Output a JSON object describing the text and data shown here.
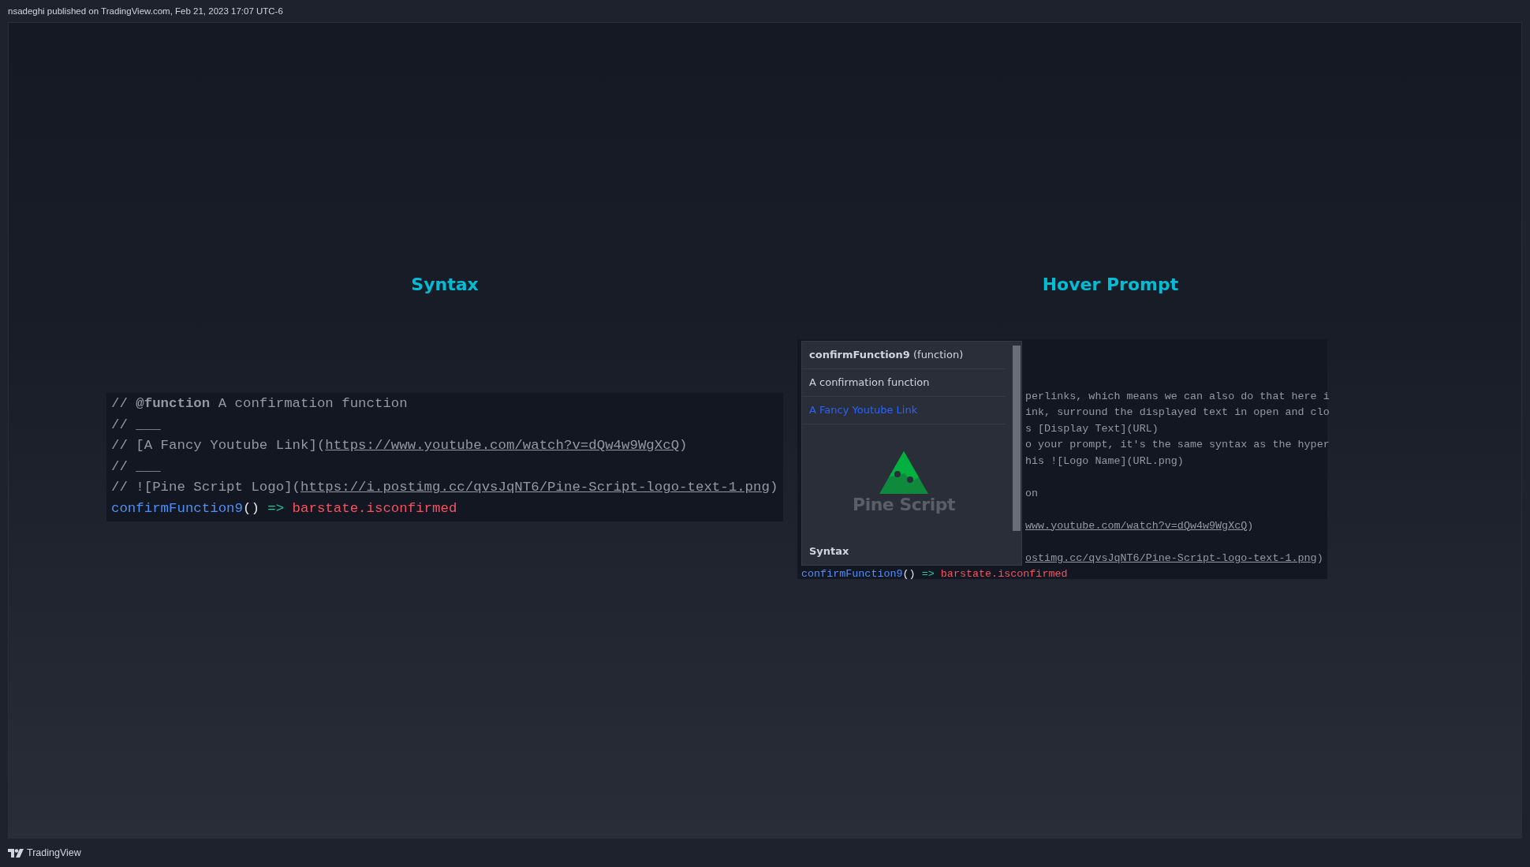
{
  "header": {
    "byline": "nsadeghi published on TradingView.com, Feb 21, 2023 17:07 UTC-6"
  },
  "syntax_panel": {
    "title": "Syntax",
    "lines": [
      {
        "segments": [
          {
            "text": "// ",
            "kind": "comment"
          },
          {
            "text": "@function",
            "kind": "tag"
          },
          {
            "text": " A confirmation function",
            "kind": "comment"
          }
        ]
      },
      {
        "segments": [
          {
            "text": "// ___",
            "kind": "comment"
          }
        ]
      },
      {
        "segments": [
          {
            "text": "// [A Fancy Youtube Link](",
            "kind": "comment"
          },
          {
            "text": "https://www.youtube.com/watch?v=dQw4w9WgXcQ",
            "kind": "link"
          },
          {
            "text": ")",
            "kind": "comment"
          }
        ]
      },
      {
        "segments": [
          {
            "text": "// ___",
            "kind": "comment"
          }
        ]
      },
      {
        "segments": [
          {
            "text": "// ![Pine Script Logo](",
            "kind": "comment"
          },
          {
            "text": "https://i.postimg.cc/qvsJqNT6/Pine-Script-logo-text-1.png",
            "kind": "link"
          },
          {
            "text": ")",
            "kind": "comment"
          }
        ]
      },
      {
        "segments": [
          {
            "text": "confirmFunction9",
            "kind": "func"
          },
          {
            "text": "()",
            "kind": "paren"
          },
          {
            "text": " => ",
            "kind": "op"
          },
          {
            "text": "barstate.isconfirmed",
            "kind": "builtin"
          }
        ]
      }
    ]
  },
  "hover_panel": {
    "title": "Hover Prompt",
    "lines": [
      {
        "kind": "blank"
      },
      {
        "kind": "blank"
      },
      {
        "kind": "blank"
      },
      {
        "kind": "covered",
        "segments": [
          {
            "text": "perlinks, which means we can also do that here i",
            "kind": "comment"
          }
        ]
      },
      {
        "kind": "covered",
        "segments": [
          {
            "text": "ink, surround the displayed text in open and clo",
            "kind": "comment"
          }
        ]
      },
      {
        "kind": "covered",
        "segments": [
          {
            "text": "s [Display Text](URL)",
            "kind": "comment"
          }
        ]
      },
      {
        "kind": "covered",
        "segments": [
          {
            "text": "o your prompt, it's the same syntax as the hyper",
            "kind": "comment"
          }
        ]
      },
      {
        "kind": "covered",
        "segments": [
          {
            "text": "his ![Logo Name](URL.png)",
            "kind": "comment"
          }
        ]
      },
      {
        "kind": "blank"
      },
      {
        "kind": "covered",
        "segments": [
          {
            "text": "on",
            "kind": "comment"
          }
        ]
      },
      {
        "kind": "blank"
      },
      {
        "kind": "covered",
        "segments": [
          {
            "text": "www.youtube.com/watch?v=dQw4w9WgXcQ",
            "kind": "link"
          },
          {
            "text": ")",
            "kind": "comment"
          }
        ]
      },
      {
        "kind": "blank"
      },
      {
        "kind": "covered",
        "segments": [
          {
            "text": "ostimg.cc/qvsJqNT6/Pine-Script-logo-text-1.png",
            "kind": "link"
          },
          {
            "text": ")",
            "kind": "comment"
          }
        ]
      },
      {
        "kind": "code",
        "segments": [
          {
            "text": "confirmFunction9",
            "kind": "func"
          },
          {
            "text": "()",
            "kind": "paren"
          },
          {
            "text": " => ",
            "kind": "op"
          },
          {
            "text": "barstate.isconfirmed",
            "kind": "builtin"
          }
        ]
      }
    ],
    "popup": {
      "name": "confirmFunction9",
      "type": "(function)",
      "description": "A confirmation function",
      "link": "A Fancy Youtube Link",
      "logo_text": "Pine Script",
      "section": "Syntax"
    }
  },
  "footer": {
    "brand": "TradingView"
  }
}
